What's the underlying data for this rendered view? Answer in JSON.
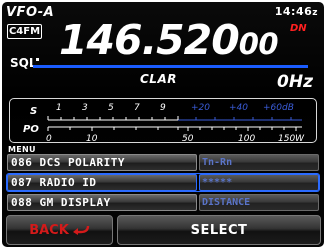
{
  "status": {
    "vfo_label": "VFO-A",
    "mode_badge": "C4FM",
    "clock": "14:46",
    "clock_suffix": "z",
    "sql_label": "SQL"
  },
  "frequency": {
    "main": "146.520",
    "sub": "00",
    "indicator": "DN"
  },
  "clar": {
    "label": "CLAR",
    "value": "0Hz"
  },
  "meter": {
    "s_label": "S",
    "po_label": "PO",
    "s_scale_white": [
      "1",
      "3",
      "5",
      "7",
      "9"
    ],
    "s_scale_blue": [
      "+20",
      "+40",
      "+60dB"
    ],
    "po_scale": [
      "0",
      "10",
      "50",
      "100",
      "150W"
    ]
  },
  "menu": {
    "title": "MENU",
    "items": [
      {
        "number": "086",
        "name": "DCS POLARITY",
        "value": "Tn-Rn",
        "selected": false
      },
      {
        "number": "087",
        "name": "RADIO ID",
        "value": "*****",
        "selected": true
      },
      {
        "number": "088",
        "name": "GM DISPLAY",
        "value": "DISTANCE",
        "selected": false
      }
    ]
  },
  "buttons": {
    "back_label": "BACK",
    "back_icon": "return-arrow-icon",
    "select_label": "SELECT"
  },
  "colors": {
    "accent_blue": "#1a5cff",
    "indicator_red": "#ff2020",
    "back_red": "#d41a1a",
    "value_blue": "#5a74c8"
  }
}
